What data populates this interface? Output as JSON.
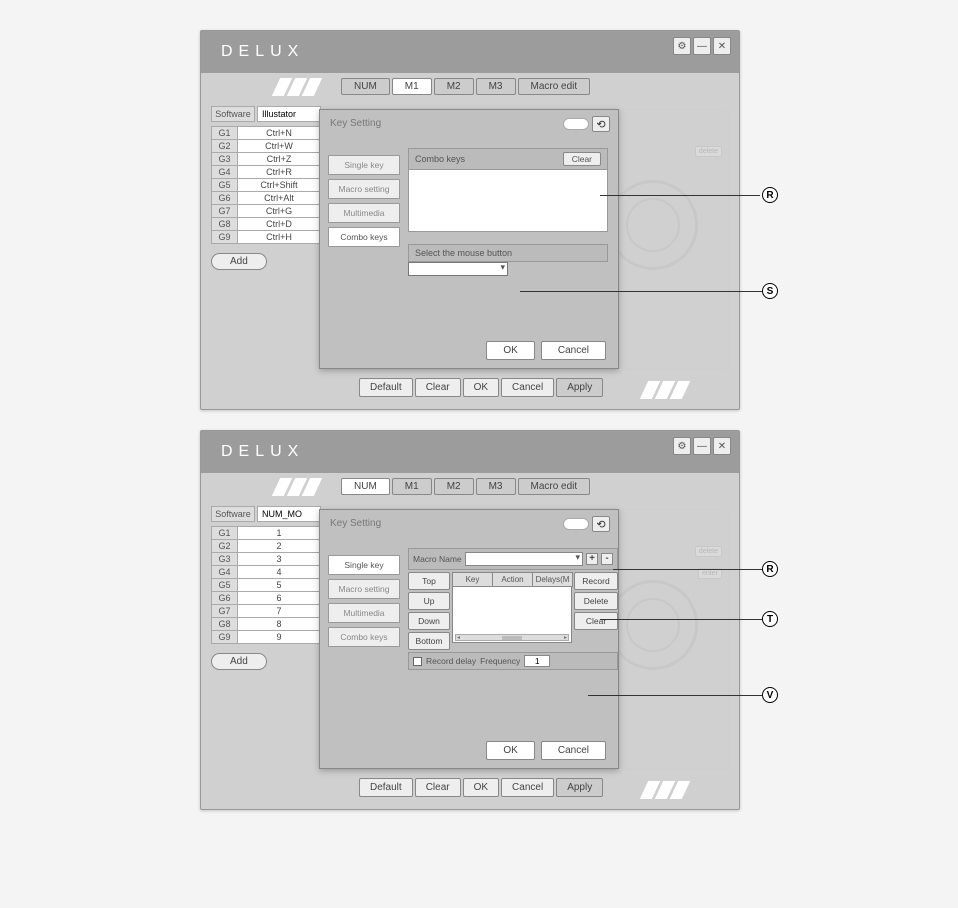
{
  "logo": "DELUX",
  "win_controls": {
    "settings": "⚙",
    "minimize": "—",
    "close": "✕"
  },
  "tabs": [
    "NUM",
    "M1",
    "M2",
    "M3",
    "Macro edit"
  ],
  "software_label": "Software",
  "add_label": "Add",
  "footer": [
    "Default",
    "Clear",
    "OK",
    "Cancel",
    "Apply"
  ],
  "modal_title": "Key Setting",
  "side_options": [
    "Single key",
    "Macro setting",
    "Multimedia",
    "Combo keys"
  ],
  "modal_ok": "OK",
  "modal_cancel": "Cancel",
  "screen1": {
    "active_tab": "M1",
    "software_value": "Illustator",
    "grows": [
      [
        "G1",
        "Ctrl+N"
      ],
      [
        "G2",
        "Ctrl+W"
      ],
      [
        "G3",
        "Ctrl+Z"
      ],
      [
        "G4",
        "Ctrl+R"
      ],
      [
        "G5",
        "Ctrl+Shift"
      ],
      [
        "G6",
        "Ctrl+Alt"
      ],
      [
        "G7",
        "Ctrl+G"
      ],
      [
        "G8",
        "Ctrl+D"
      ],
      [
        "G9",
        "Ctrl+H"
      ]
    ],
    "selected_side": "Combo keys",
    "combo_keys_label": "Combo keys",
    "clear_label": "Clear",
    "select_mouse_label": "Select the mouse button",
    "bg_btn": "delete"
  },
  "screen2": {
    "active_tab": "NUM",
    "software_value": "NUM_MO",
    "grows": [
      [
        "G1",
        "1"
      ],
      [
        "G2",
        "2"
      ],
      [
        "G3",
        "3"
      ],
      [
        "G4",
        "4"
      ],
      [
        "G5",
        "5"
      ],
      [
        "G6",
        "6"
      ],
      [
        "G7",
        "7"
      ],
      [
        "G8",
        "8"
      ],
      [
        "G9",
        "9"
      ]
    ],
    "selected_side": "Single key",
    "macro_name_label": "Macro Name",
    "plus": "+",
    "minus": "-",
    "rec_left": [
      "Top",
      "Up",
      "Down",
      "Bottom"
    ],
    "rec_head": [
      "Key",
      "Action",
      "Delays(M"
    ],
    "rec_right": [
      "Record",
      "Delete",
      "Clear"
    ],
    "record_delay_label": "Record delay",
    "frequency_label": "Frequency",
    "frequency_value": "1",
    "bg_btn1": "delete",
    "bg_btn2": "enter"
  },
  "callouts": {
    "R": "R",
    "S": "S",
    "T": "T",
    "V": "V"
  }
}
